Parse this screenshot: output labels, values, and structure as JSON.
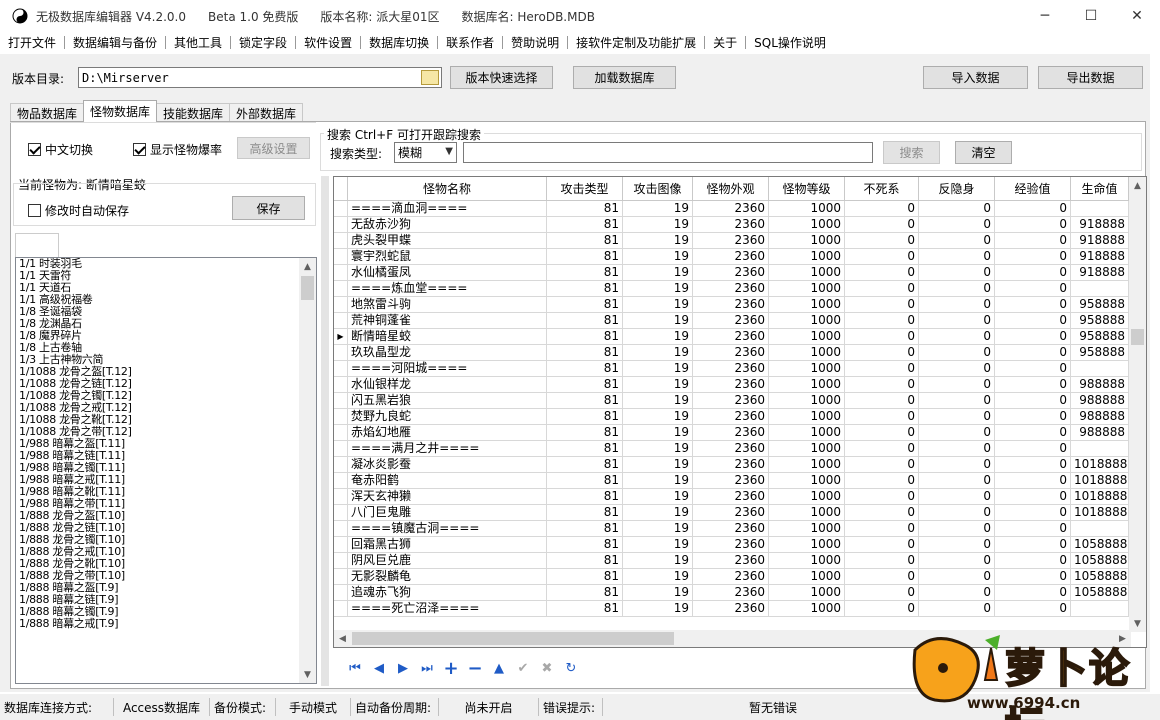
{
  "titlebar": {
    "app_name": "无极数据库编辑器 V4.2.0.0",
    "edition": "Beta 1.0 免费版",
    "version_name": "版本名称: 派大星01区",
    "db_name": "数据库名: HeroDB.MDB",
    "minimize": "─",
    "maximize": "☐",
    "close": "✕"
  },
  "menu": [
    "打开文件",
    "数据编辑与备份",
    "其他工具",
    "锁定字段",
    "软件设置",
    "数据库切换",
    "联系作者",
    "赞助说明",
    "接软件定制及功能扩展",
    "关于",
    "SQL操作说明"
  ],
  "toolbar": {
    "dir_label": "版本目录:",
    "dir_value": "D:\\Mirserver",
    "quick_select": "版本快速选择",
    "load_db": "加载数据库",
    "import": "导入数据",
    "export": "导出数据"
  },
  "tabs": [
    "物品数据库",
    "怪物数据库",
    "技能数据库",
    "外部数据库"
  ],
  "active_tab": 1,
  "options": {
    "chinese_switch": "中文切换",
    "show_drop_rate": "显示怪物爆率",
    "advanced": "高级设置"
  },
  "search": {
    "title": "搜索  Ctrl+F 可打开跟踪搜索",
    "type_label": "搜索类型:",
    "type_value": "模糊",
    "query": "",
    "search_btn": "搜索",
    "clear_btn": "清空"
  },
  "left": {
    "current_monster": "当前怪物为: 断情暗星蛟",
    "auto_save": "修改时自动保存",
    "save_btn": "保存",
    "drops": [
      "1/1 时装羽毛",
      "1/1 天雷符",
      "1/1 天道石",
      "1/1 高级祝福卷",
      "1/8 圣诞福袋",
      "1/8 龙渊晶石",
      "1/8 魔界碎片",
      "1/8 上古卷轴",
      "1/3 上古神物六简",
      "1/1088 龙骨之盔[T.12]",
      "1/1088 龙骨之链[T.12]",
      "1/1088 龙骨之镯[T.12]",
      "1/1088 龙骨之戒[T.12]",
      "1/1088 龙骨之靴[T.12]",
      "1/1088 龙骨之带[T.12]",
      "1/988 暗幕之盔[T.11]",
      "1/988 暗幕之链[T.11]",
      "1/988 暗幕之镯[T.11]",
      "1/988 暗幕之戒[T.11]",
      "1/988 暗幕之靴[T.11]",
      "1/988 暗幕之带[T.11]",
      "1/888 龙骨之盔[T.10]",
      "1/888 龙骨之链[T.10]",
      "1/888 龙骨之镯[T.10]",
      "1/888 龙骨之戒[T.10]",
      "1/888 龙骨之靴[T.10]",
      "1/888 龙骨之带[T.10]",
      "1/888 暗幕之盔[T.9]",
      "1/888 暗幕之链[T.9]",
      "1/888 暗幕之镯[T.9]",
      "1/888 暗幕之戒[T.9]"
    ]
  },
  "grid": {
    "columns": [
      "怪物名称",
      "攻击类型",
      "攻击图像",
      "怪物外观",
      "怪物等级",
      "不死系",
      "反隐身",
      "经验值",
      "生命值"
    ],
    "selected_row": 8,
    "rows": [
      [
        "====滴血洞====",
        "81",
        "19",
        "2360",
        "1000",
        "0",
        "0",
        "0",
        ""
      ],
      [
        "无敌赤沙狗",
        "81",
        "19",
        "2360",
        "1000",
        "0",
        "0",
        "0",
        "918888"
      ],
      [
        "虎头裂甲蝶",
        "81",
        "19",
        "2360",
        "1000",
        "0",
        "0",
        "0",
        "918888"
      ],
      [
        "寰宇烈蛇鼠",
        "81",
        "19",
        "2360",
        "1000",
        "0",
        "0",
        "0",
        "918888"
      ],
      [
        "水仙橘蛋凤",
        "81",
        "19",
        "2360",
        "1000",
        "0",
        "0",
        "0",
        "918888"
      ],
      [
        "====炼血堂====",
        "81",
        "19",
        "2360",
        "1000",
        "0",
        "0",
        "0",
        ""
      ],
      [
        "地煞雷斗驹",
        "81",
        "19",
        "2360",
        "1000",
        "0",
        "0",
        "0",
        "958888"
      ],
      [
        "荒神铜蓬雀",
        "81",
        "19",
        "2360",
        "1000",
        "0",
        "0",
        "0",
        "958888"
      ],
      [
        "断情暗星蛟",
        "81",
        "19",
        "2360",
        "1000",
        "0",
        "0",
        "0",
        "958888"
      ],
      [
        "玖玖晶型龙",
        "81",
        "19",
        "2360",
        "1000",
        "0",
        "0",
        "0",
        "958888"
      ],
      [
        "====河阳城====",
        "81",
        "19",
        "2360",
        "1000",
        "0",
        "0",
        "0",
        ""
      ],
      [
        "水仙银样龙",
        "81",
        "19",
        "2360",
        "1000",
        "0",
        "0",
        "0",
        "988888"
      ],
      [
        "闪五黑岩狼",
        "81",
        "19",
        "2360",
        "1000",
        "0",
        "0",
        "0",
        "988888"
      ],
      [
        "焚野九良蛇",
        "81",
        "19",
        "2360",
        "1000",
        "0",
        "0",
        "0",
        "988888"
      ],
      [
        "赤焰幻地雁",
        "81",
        "19",
        "2360",
        "1000",
        "0",
        "0",
        "0",
        "988888"
      ],
      [
        "====满月之井====",
        "81",
        "19",
        "2360",
        "1000",
        "0",
        "0",
        "0",
        ""
      ],
      [
        "凝冰炎影蚕",
        "81",
        "19",
        "2360",
        "1000",
        "0",
        "0",
        "0",
        "1018888"
      ],
      [
        "奄赤阳鹤",
        "81",
        "19",
        "2360",
        "1000",
        "0",
        "0",
        "0",
        "1018888"
      ],
      [
        "浑天玄神獭",
        "81",
        "19",
        "2360",
        "1000",
        "0",
        "0",
        "0",
        "1018888"
      ],
      [
        "八门巨鬼雕",
        "81",
        "19",
        "2360",
        "1000",
        "0",
        "0",
        "0",
        "1018888"
      ],
      [
        "====镇魔古洞====",
        "81",
        "19",
        "2360",
        "1000",
        "0",
        "0",
        "0",
        ""
      ],
      [
        "回霜黑古狮",
        "81",
        "19",
        "2360",
        "1000",
        "0",
        "0",
        "0",
        "1058888"
      ],
      [
        "阴风巨兑鹿",
        "81",
        "19",
        "2360",
        "1000",
        "0",
        "0",
        "0",
        "1058888"
      ],
      [
        "无影裂麟龟",
        "81",
        "19",
        "2360",
        "1000",
        "0",
        "0",
        "0",
        "1058888"
      ],
      [
        "追魂赤飞狗",
        "81",
        "19",
        "2360",
        "1000",
        "0",
        "0",
        "0",
        "1058888"
      ],
      [
        "====死亡沼泽====",
        "81",
        "19",
        "2360",
        "1000",
        "0",
        "0",
        "0",
        ""
      ]
    ]
  },
  "navigator": [
    "first",
    "prior",
    "next",
    "last",
    "insert",
    "delete",
    "edit",
    "post",
    "cancel",
    "refresh"
  ],
  "status": {
    "conn_label": "数据库连接方式:",
    "conn_value": "Access数据库",
    "backup_label": "备份模式:",
    "backup_value": "手动模式",
    "auto_label": "自动备份周期:",
    "auto_value": "尚未开启",
    "error_label": "错误提示:",
    "error_value": "暂无错误"
  },
  "watermark": {
    "text": "萝卜论坛",
    "url": "www.6994.cn"
  }
}
